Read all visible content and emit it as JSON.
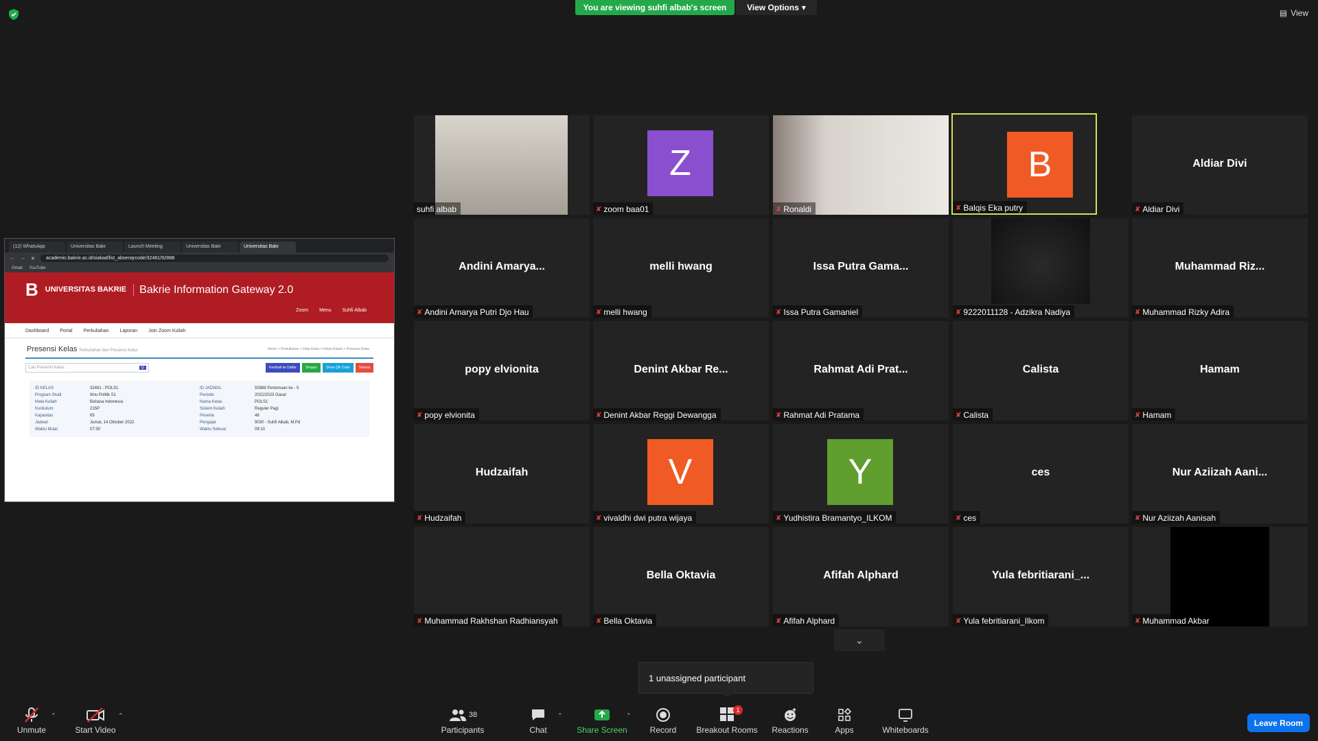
{
  "banner": {
    "viewing": "You are viewing suhfi albab's screen",
    "view_options": "View Options",
    "view": "View"
  },
  "shared_screen": {
    "tabs": [
      "(12) WhatsApp",
      "Universitas Bakr",
      "Launch Meeting",
      "Universitas Bakr",
      "Universitas Bakr"
    ],
    "url": "academic.bakrie.ac.id/siakad/list_absenqrcode/32481/92888",
    "bookmarks": [
      "Gmail",
      "YouTube"
    ],
    "logo_text": "UNIVERSITAS BAKRIE",
    "site_title": "Bakrie Information Gateway 2.0",
    "header_links": [
      "Zoom",
      "Menu",
      "Suhfi Albab"
    ],
    "nav": [
      "Dashboard",
      "Portal",
      "Perkuliahan",
      "Laporan",
      "Join Zoom Kuliah"
    ],
    "page_title": "Presensi Kelas",
    "page_subtitle": "Perkuliahan dan Presensi Kelas",
    "breadcrumb": "Home > Perkuliahan > Data Kelas > Kelas Kuliah > Presensi Kelas",
    "search_placeholder": "Cari Presensi Kelas",
    "buttons": [
      "Kembali ke Daftar",
      "Simpan",
      "Show QR Code",
      "Selesai"
    ],
    "info": [
      {
        "k1": "ID KELAS",
        "v1": "32481 - POLS1",
        "k2": "ID JADWAL",
        "v2": "92888 Pertemuan ke - 5"
      },
      {
        "k1": "Program Studi",
        "v1": "Ilmu Politik S1",
        "k2": "Periode",
        "v2": "2022/2023 Gasal"
      },
      {
        "k1": "Mata Kuliah",
        "v1": "Bahasa Indonesia",
        "k2": "Nama Kelas",
        "v2": "POLS1"
      },
      {
        "k1": "Kurikulum",
        "v1": "215P",
        "k2": "Sistem Kuliah",
        "v2": "Reguler Pagi"
      },
      {
        "k1": "Kapasitas",
        "v1": "65",
        "k2": "Peserta",
        "v2": "48"
      },
      {
        "k1": "Jadwal",
        "v1": "Jumat, 14 Oktober 2022",
        "k2": "Pengajar",
        "v2": "9030 - Suhfi Albab, M.Pd"
      },
      {
        "k1": "Waktu Mulai",
        "v1": "07:30",
        "k2": "Waktu Selesai",
        "v2": "09:10"
      }
    ]
  },
  "participants": [
    {
      "label": "suhfi albab",
      "type": "photo",
      "muted": false
    },
    {
      "label": "zoom baa01",
      "type": "avatar",
      "letter": "Z",
      "color": "#8a4fcf",
      "muted": true
    },
    {
      "label": "Ronaldi",
      "type": "photo",
      "muted": true
    },
    {
      "label": "Balqis Eka putry",
      "type": "avatar",
      "letter": "B",
      "color": "#f05a24",
      "muted": true,
      "highlight": true
    },
    {
      "label": "Aldiar Divi",
      "type": "name",
      "name": "Aldiar Divi",
      "muted": true
    },
    {
      "label": "Andini Amarya Putri Djo Hau",
      "type": "name",
      "name": "Andini  Amarya...",
      "muted": true
    },
    {
      "label": "melli hwang",
      "type": "name",
      "name": "melli hwang",
      "muted": true
    },
    {
      "label": "Issa Putra Gamaniel",
      "type": "name",
      "name": "Issa Putra Gama...",
      "muted": true
    },
    {
      "label": "9222011128 - Adzikra Nadiya",
      "type": "photo",
      "muted": true
    },
    {
      "label": "Muhammad Rizky Adira",
      "type": "name",
      "name": "Muhammad  Riz...",
      "muted": true
    },
    {
      "label": "popy elvionita",
      "type": "name",
      "name": "popy elvionita",
      "muted": true
    },
    {
      "label": "Denint Akbar Reggi Dewangga",
      "type": "name",
      "name": "Denint  Akbar  Re...",
      "muted": true
    },
    {
      "label": "Rahmat Adi Pratama",
      "type": "name",
      "name": "Rahmat Adi Prat...",
      "muted": true
    },
    {
      "label": "Calista",
      "type": "name",
      "name": "Calista",
      "muted": true
    },
    {
      "label": "Hamam",
      "type": "name",
      "name": "Hamam",
      "muted": true
    },
    {
      "label": "Hudzaifah",
      "type": "name",
      "name": "Hudzaifah",
      "muted": true
    },
    {
      "label": "vivaldhi dwi putra wijaya",
      "type": "avatar",
      "letter": "V",
      "color": "#f05a24",
      "muted": true
    },
    {
      "label": "Yudhistira Bramantyo_ILKOM",
      "type": "avatar",
      "letter": "Y",
      "color": "#5f9e2f",
      "muted": true
    },
    {
      "label": "ces",
      "type": "name",
      "name": "ces",
      "muted": true
    },
    {
      "label": "Nur Aziizah Aanisah",
      "type": "name",
      "name": "Nur  Aziizah  Aani...",
      "muted": true
    },
    {
      "label": "Muhammad Rakhshan Radhiansyah",
      "type": "blank",
      "muted": true
    },
    {
      "label": "Bella Oktavia",
      "type": "name",
      "name": "Bella Oktavia",
      "muted": true
    },
    {
      "label": "Afifah Alphard",
      "type": "name",
      "name": "Afifah Alphard",
      "muted": true
    },
    {
      "label": "Yula febritiarani_Ilkom",
      "type": "name",
      "name": "Yula  febritiarani_...",
      "muted": true
    },
    {
      "label": "Muhammad Akbar",
      "type": "black",
      "muted": true
    }
  ],
  "unassigned": "1 unassigned participant",
  "toolbar": {
    "unmute": "Unmute",
    "start_video": "Start Video",
    "participants": "Participants",
    "participants_count": "38",
    "chat": "Chat",
    "share_screen": "Share Screen",
    "record": "Record",
    "breakout_rooms": "Breakout Rooms",
    "breakout_badge": "1",
    "reactions": "Reactions",
    "apps": "Apps",
    "whiteboards": "Whiteboards",
    "leave": "Leave Room"
  },
  "colors": {
    "share_green": "#23a94a",
    "leave_blue": "#0e72ed",
    "highlight": "#d4e157",
    "site_red": "#b01c23"
  }
}
